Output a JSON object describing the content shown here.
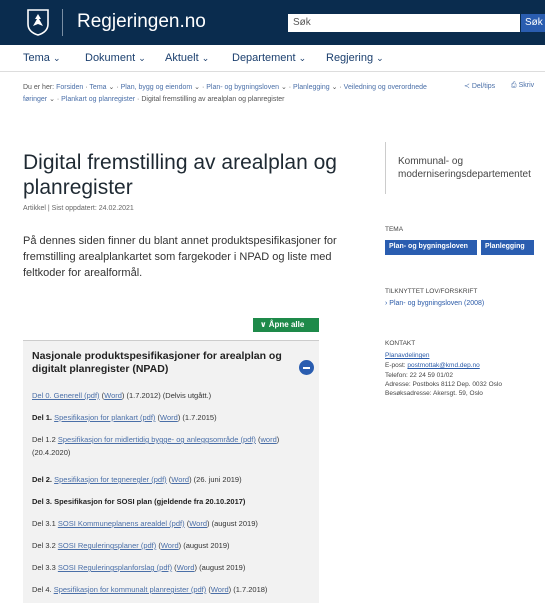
{
  "header": {
    "site_name": "Regjeringen.no",
    "search_placeholder": "Søk",
    "search_button": "Søk"
  },
  "nav": {
    "items": [
      "Tema",
      "Dokument",
      "Aktuelt",
      "Departement",
      "Regjering"
    ],
    "caret": "⌄"
  },
  "breadcrumb": {
    "prefix": "Du er her:",
    "items": [
      "Forsiden",
      "Tema",
      "Plan, bygg og eiendom",
      "Plan- og bygningsloven",
      "Planlegging",
      "Veiledning og overordnede føringer",
      "Plankart og planregister"
    ],
    "current": "Digital fremstilling av arealplan og planregister"
  },
  "tools": {
    "share": "Del/tips",
    "print": "Skriv"
  },
  "page": {
    "title": "Digital fremstilling av arealplan og planregister",
    "meta": "Artikkel | Sist oppdatert: 24.02.2021",
    "intro": "På dennes siden finner du blant annet produktspesifikasjoner for fremstilling arealplankartet som fargekoder i NPAD og liste med feltkoder for arealformål."
  },
  "expand_all": "∨ Åpne alle",
  "accordion": {
    "title": "Nasjonale produktspesifikasjoner for arealplan og digitalt planregister (NPAD)"
  },
  "aside": {
    "org": "Kommunal- og moderniseringsdepartementet",
    "tema_heading": "TEMA",
    "tags": [
      "Plan- og bygningsloven",
      "Planlegging"
    ],
    "law_heading": "TILKNYTTET LOV/FORSKRIFT",
    "law_link": "Plan- og bygningsloven (2008)",
    "contact_heading": "KONTAKT",
    "contact_name": "Planavdelingen",
    "email_label": "E-post:",
    "email": "postmottak@kmd.dep.no",
    "phone": "Telefon: 22 24 59 01/02",
    "address": "Adresse: Postboks 8112 Dep. 0032 Oslo",
    "visit": "Besøksadresse: Akersgt. 59, Oslo"
  }
}
